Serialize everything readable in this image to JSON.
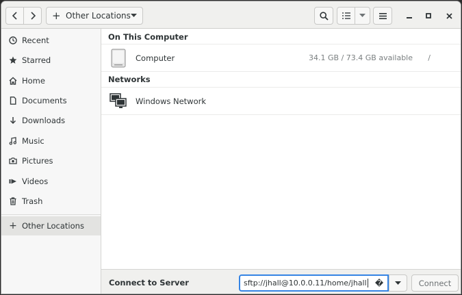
{
  "header": {
    "path_label": "Other Locations",
    "path_icon": "plus-icon"
  },
  "sidebar": {
    "items": [
      {
        "label": "Recent",
        "icon": "clock-icon"
      },
      {
        "label": "Starred",
        "icon": "star-icon"
      },
      {
        "label": "Home",
        "icon": "home-icon"
      },
      {
        "label": "Documents",
        "icon": "document-icon"
      },
      {
        "label": "Downloads",
        "icon": "download-icon"
      },
      {
        "label": "Music",
        "icon": "music-icon"
      },
      {
        "label": "Pictures",
        "icon": "camera-icon"
      },
      {
        "label": "Videos",
        "icon": "video-icon"
      },
      {
        "label": "Trash",
        "icon": "trash-icon"
      },
      {
        "label": "Other Locations",
        "icon": "plus-icon",
        "active": true
      }
    ]
  },
  "main": {
    "sections": [
      {
        "title": "On This Computer",
        "rows": [
          {
            "name": "Computer",
            "meta": "34.1 GB / 73.4 GB available",
            "mount": "/",
            "icon": "hard-drive-icon"
          }
        ]
      },
      {
        "title": "Networks",
        "rows": [
          {
            "name": "Windows Network",
            "icon": "network-icon"
          }
        ]
      }
    ]
  },
  "connect": {
    "label": "Connect to Server",
    "server_value": "sftp://jhall@10.0.0.11/home/jhall",
    "help_glyph": "�",
    "button_label": "Connect"
  },
  "colors": {
    "accent": "#3584e4",
    "headerbar": "#f0f0ee",
    "sidebar": "#f7f7f7",
    "sidebar_active": "#e3e3e1"
  }
}
